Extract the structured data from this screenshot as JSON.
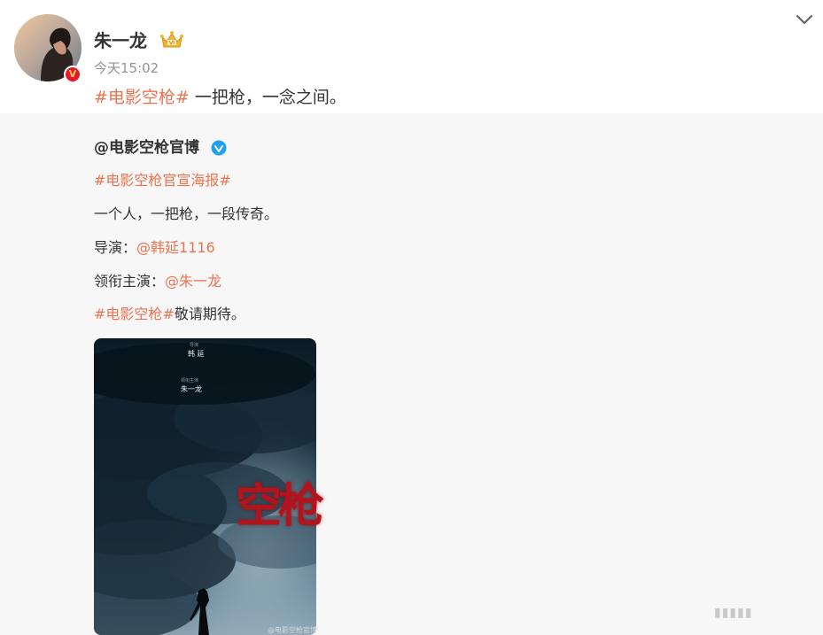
{
  "post": {
    "username": "朱一龙",
    "timestamp": "今天15:02",
    "hashtag": "#电影空枪#",
    "text": " 一把枪，一念之间。",
    "verified_badge": "V"
  },
  "repost": {
    "author": "@电影空枪官博",
    "hashtag_poster": "#电影空枪官宣海报#",
    "line_tagline": "一个人，一把枪，一段传奇。",
    "director_label": "导演：",
    "director_link": "@韩延1116",
    "lead_label": "领衔主演：",
    "lead_link": "@朱一龙",
    "closing_hashtag": "#电影空枪#",
    "closing_text": "敬请期待。"
  },
  "poster": {
    "director_label": "导演",
    "director_name": "韩 延",
    "star_label": "领衔主演",
    "star_name": "朱一龙",
    "title": "空枪",
    "watermark": "@电影空枪官博"
  },
  "colors": {
    "accent": "#eb7350",
    "text": "#333333",
    "muted": "#939393",
    "repost_bg": "#f7f7f7",
    "verified_blue": "#1da1f2",
    "badge_red": "#e6162d"
  },
  "icons": {
    "expand": "chevron-down-icon",
    "vip": "crown-icon",
    "verified": "verified-v-icon"
  }
}
